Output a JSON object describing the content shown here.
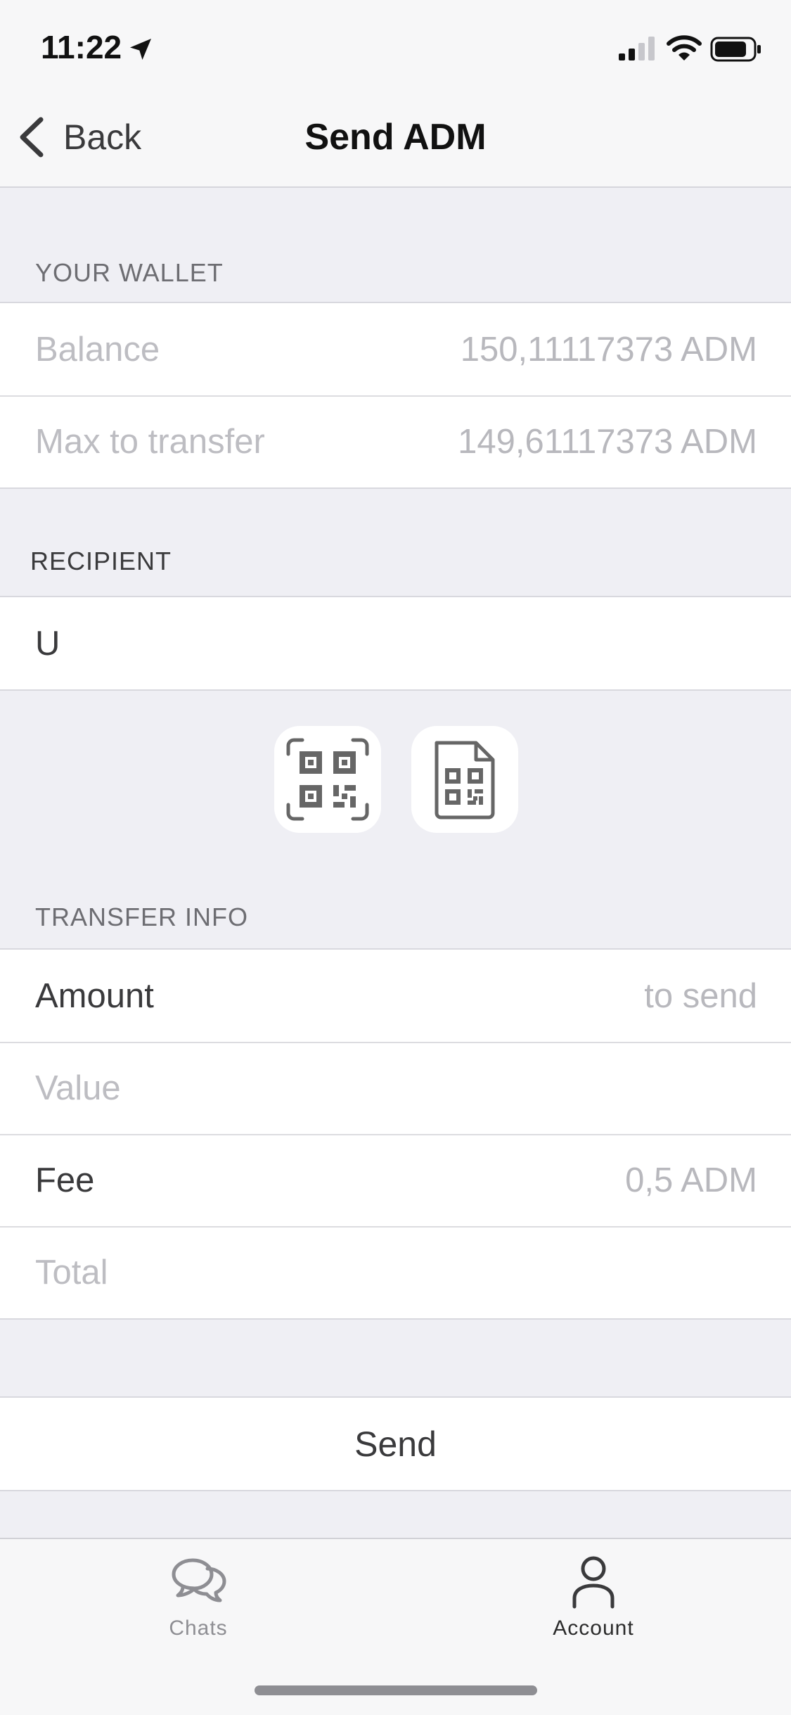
{
  "status_bar": {
    "time": "11:22"
  },
  "nav": {
    "back_label": "Back",
    "title": "Send ADM"
  },
  "wallet": {
    "header": "YOUR WALLET",
    "balance_label": "Balance",
    "balance_value": "150,11117373 ADM",
    "max_label": "Max to transfer",
    "max_value": "149,61117373 ADM"
  },
  "recipient": {
    "header": "RECIPIENT",
    "value": "U"
  },
  "transfer": {
    "header": "TRANSFER INFO",
    "amount_label": "Amount",
    "amount_placeholder": "to send",
    "value_label": "Value",
    "fee_label": "Fee",
    "fee_value": "0,5 ADM",
    "total_label": "Total"
  },
  "actions": {
    "send_label": "Send"
  },
  "tabbar": {
    "chats_label": "Chats",
    "account_label": "Account"
  },
  "icons": [
    "location-arrow-icon",
    "signal-icon",
    "wifi-icon",
    "battery-icon",
    "back-chevron-icon",
    "qr-scan-icon",
    "qr-file-icon",
    "chats-icon",
    "account-icon"
  ]
}
